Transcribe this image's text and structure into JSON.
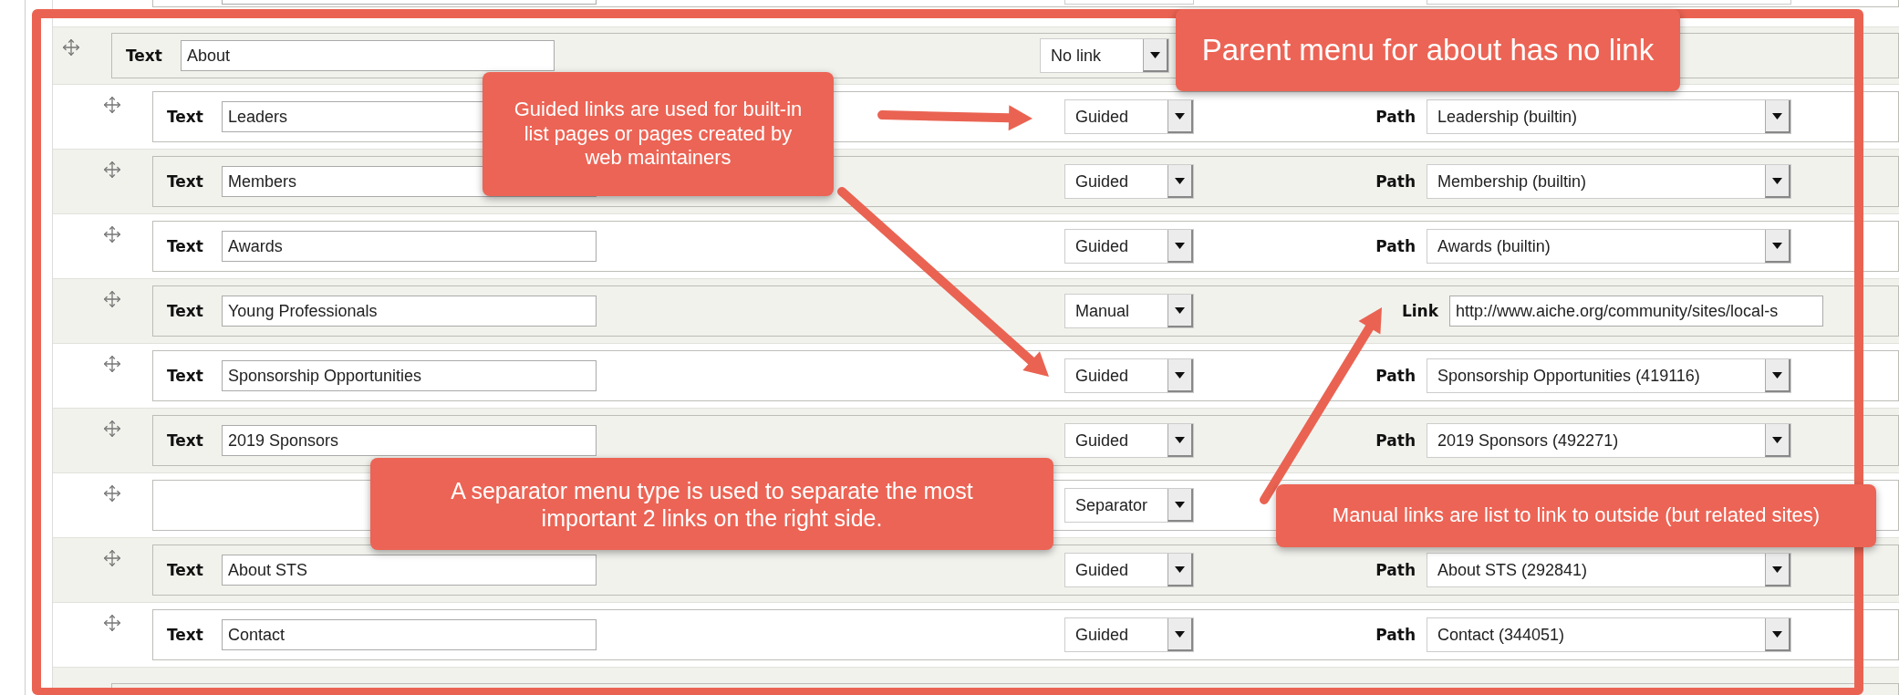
{
  "menu": {
    "text_label": "Text",
    "text": "About",
    "type": "No link",
    "children": [
      {
        "kind": "guided",
        "text_label": "Text",
        "text": "Leaders",
        "type": "Guided",
        "target_label": "Path",
        "target": "Leadership (builtin)"
      },
      {
        "kind": "guided",
        "text_label": "Text",
        "text": "Members",
        "type": "Guided",
        "target_label": "Path",
        "target": "Membership (builtin)"
      },
      {
        "kind": "guided",
        "text_label": "Text",
        "text": "Awards",
        "type": "Guided",
        "target_label": "Path",
        "target": "Awards (builtin)"
      },
      {
        "kind": "manual",
        "text_label": "Text",
        "text": "Young Professionals",
        "type": "Manual",
        "target_label": "Link",
        "target": "http://www.aiche.org/community/sites/local-s"
      },
      {
        "kind": "guided",
        "text_label": "Text",
        "text": "Sponsorship Opportunities",
        "type": "Guided",
        "target_label": "Path",
        "target": "Sponsorship Opportunities (419116)"
      },
      {
        "kind": "guided",
        "text_label": "Text",
        "text": "2019 Sponsors",
        "type": "Guided",
        "target_label": "Path",
        "target": "2019 Sponsors (492271)"
      },
      {
        "kind": "separator",
        "type": "Separator"
      },
      {
        "kind": "guided",
        "text_label": "Text",
        "text": "About STS",
        "type": "Guided",
        "target_label": "Path",
        "target": "About STS (292841)"
      },
      {
        "kind": "guided",
        "text_label": "Text",
        "text": "Contact",
        "type": "Guided",
        "target_label": "Path",
        "target": "Contact (344051)"
      }
    ]
  },
  "callouts": [
    {
      "text": "Parent menu for about has no link"
    },
    {
      "text": "Guided links are used for built-in list pages or pages created by web maintainers"
    },
    {
      "text": "A separator menu type is used to separate the most important 2 links on the right side."
    },
    {
      "text": "Manual links are list to link to outside (but related sites)"
    }
  ]
}
